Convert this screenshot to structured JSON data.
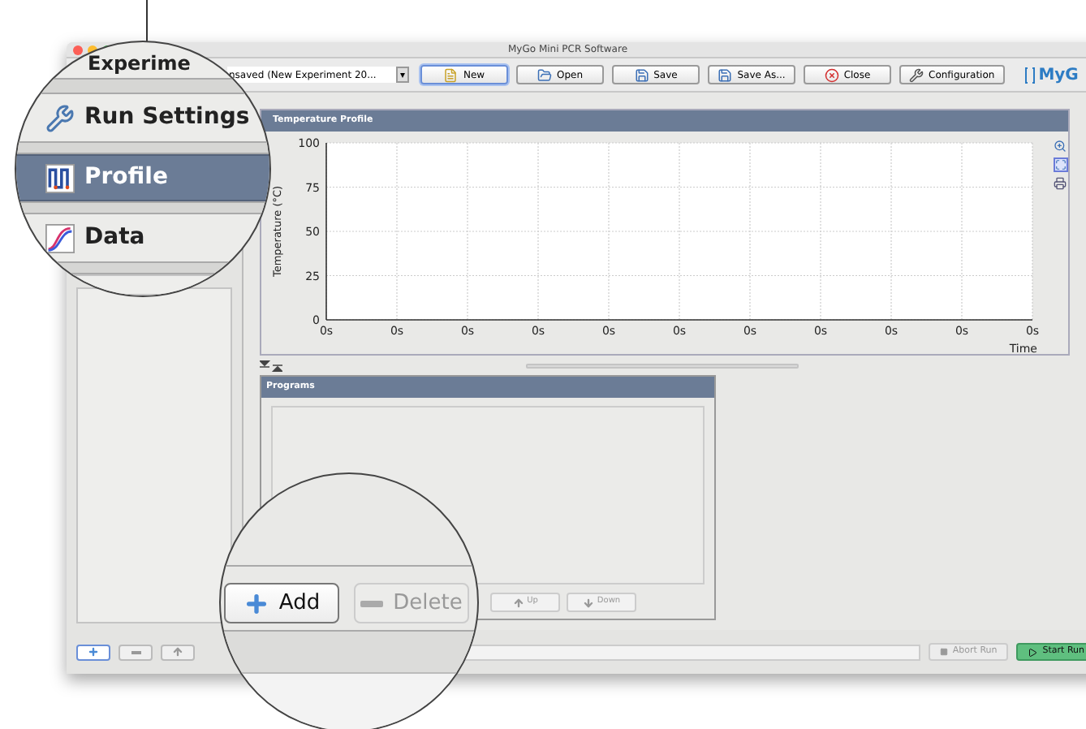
{
  "window": {
    "title": "MyGo Mini PCR Software"
  },
  "toolbar": {
    "experiment_select": {
      "value": "nsaved (New Experiment 20...",
      "arrow": "▾"
    },
    "buttons": [
      {
        "label": "New",
        "kind": "new",
        "focused": true
      },
      {
        "label": "Open",
        "kind": "open",
        "focused": false
      },
      {
        "label": "Save",
        "kind": "save",
        "focused": false
      },
      {
        "label": "Save As...",
        "kind": "save",
        "focused": false
      },
      {
        "label": "Close",
        "kind": "close",
        "focused": false
      },
      {
        "label": "Configuration",
        "kind": "config",
        "focused": false
      }
    ],
    "logo": "MyG"
  },
  "sidebar_magnified": {
    "items": [
      {
        "label": "Experime",
        "kind": "none",
        "selected": false
      },
      {
        "label": "Run Settings",
        "kind": "tools",
        "selected": false
      },
      {
        "label": "Profile",
        "kind": "profile",
        "selected": true
      },
      {
        "label": "Data",
        "kind": "data",
        "selected": false
      }
    ]
  },
  "temperature_profile": {
    "title": "Temperature Profile",
    "chart_data": {
      "type": "line",
      "xlabel": "Time",
      "ylabel": "Temperature (°C)",
      "grid": true,
      "ylim": [
        0,
        100
      ],
      "yticks": [
        0,
        25,
        50,
        75,
        100
      ],
      "categories": [
        "0s",
        "0s",
        "0s",
        "0s",
        "0s",
        "0s",
        "0s",
        "0s",
        "0s",
        "0s",
        "0s"
      ]
    }
  },
  "programs": {
    "title": "Programs",
    "buttons": [
      {
        "label": "Add",
        "kind": "add",
        "disabled": false
      },
      {
        "label": "Delete",
        "kind": "delete",
        "disabled": true
      },
      {
        "label": "Up",
        "kind": "up",
        "disabled": true
      },
      {
        "label": "Down",
        "kind": "down",
        "disabled": true
      }
    ]
  },
  "run_buttons": [
    {
      "label": "Abort Run",
      "kind": "abort",
      "disabled": true
    },
    {
      "label": "Start Run",
      "kind": "start",
      "disabled": false
    }
  ]
}
